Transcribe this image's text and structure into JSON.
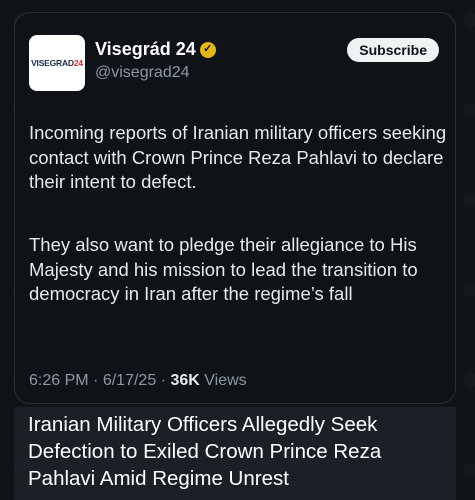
{
  "tweet": {
    "avatar_text_main": "VISEGRAD",
    "avatar_text_accent": "24",
    "display_name": "Visegrád 24",
    "verified_icon": "verified-badge-gold",
    "handle": "@visegrad24",
    "subscribe_label": "Subscribe",
    "paragraph_1": "Incoming reports of Iranian military officers seeking contact with Crown Prince Reza Pahlavi to declare their intent to defect.",
    "paragraph_2": "They also want to pledge their allegiance to His Majesty and his mission to lead the transition to democracy in Iran after the regime’s fall",
    "time": "6:26 PM",
    "separator": "·",
    "date": "6/17/25",
    "views_count": "36K",
    "views_label": "Views"
  },
  "headline": {
    "text": "Iranian Military Officers Allegedly Seek Defection to Exiled Crown Prince Reza Pahlavi Amid Regime Unrest"
  },
  "colors": {
    "background": "#101418",
    "text_primary": "#e7e9ea",
    "text_secondary": "#8b98a5",
    "verified": "#e2b719",
    "headline_bg": "#1b2026"
  }
}
